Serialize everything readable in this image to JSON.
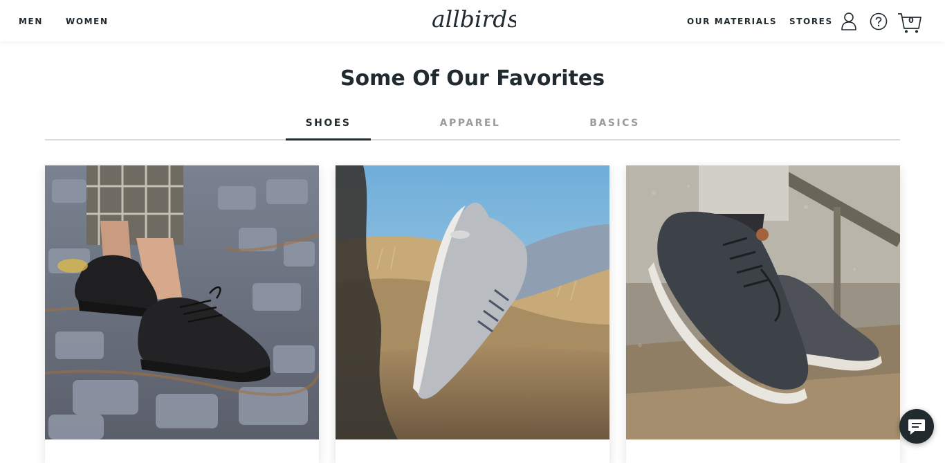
{
  "header": {
    "nav_left": [
      "MEN",
      "WOMEN"
    ],
    "logo_text": "allbirds",
    "nav_right": [
      "OUR MATERIALS",
      "STORES"
    ],
    "icons": [
      "user-icon",
      "help-icon",
      "cart-icon"
    ],
    "cart_count": "0"
  },
  "section": {
    "title": "Some Of Our Favorites",
    "tabs": [
      {
        "label": "SHOES",
        "active": true
      },
      {
        "label": "APPAREL",
        "active": false
      },
      {
        "label": "BASICS",
        "active": false
      }
    ]
  },
  "products": [
    {
      "image": "black wool runner on cobblestones"
    },
    {
      "image": "grey running shoe mid-stride on sandy path"
    },
    {
      "image": "charcoal wool runners on stone steps"
    }
  ],
  "chat": {
    "icon": "chat-icon"
  },
  "colors": {
    "text": "#212a2f",
    "inactive_tab": "#9b9b9b",
    "divider": "#dcdcdc"
  }
}
